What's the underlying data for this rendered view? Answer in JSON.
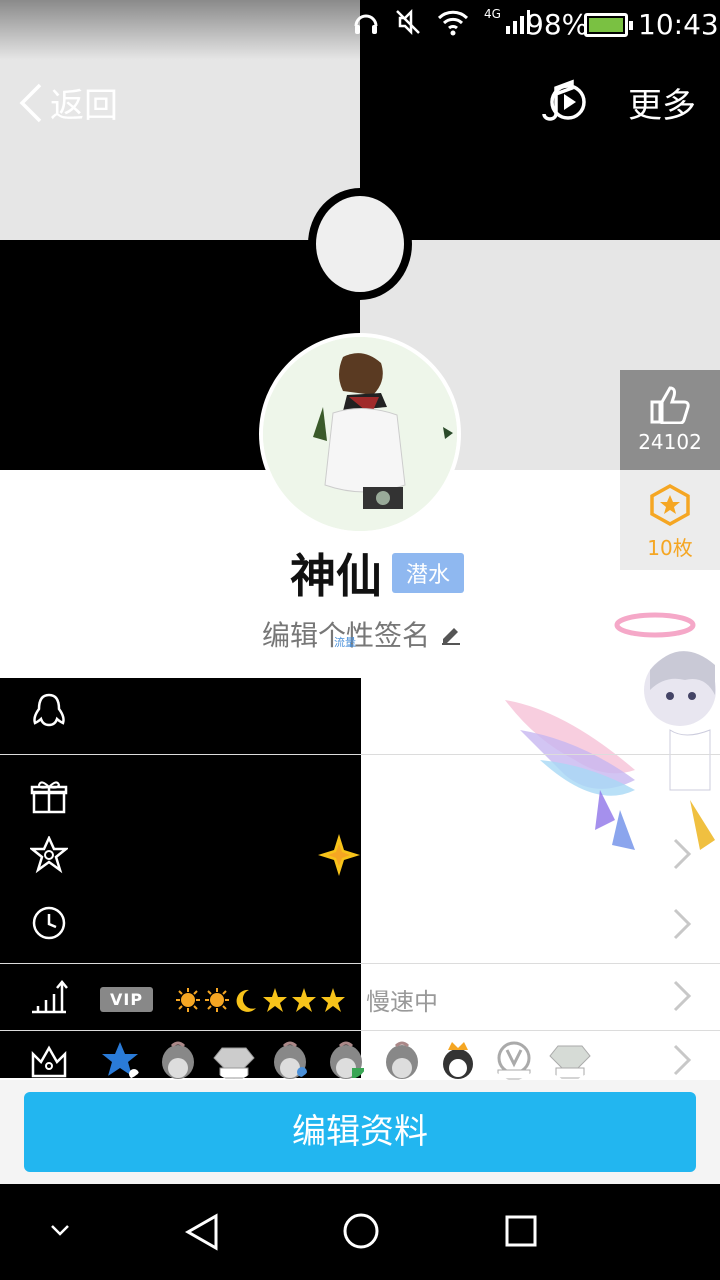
{
  "status_bar": {
    "network": "4G",
    "battery_percent": "98%",
    "time": "10:43",
    "icons": [
      "headphones-icon",
      "mute-icon",
      "wifi-icon",
      "signal-icon",
      "battery-icon"
    ]
  },
  "header": {
    "back_label": "返回",
    "more_label": "更多",
    "music_icon": "music-play-icon"
  },
  "side_panel": {
    "like_count": "24102",
    "medal_count": "10枚"
  },
  "profile": {
    "name": "神仙",
    "status_badge": "潜水",
    "signature": "编辑个性签名",
    "small_tag": "流量"
  },
  "rows": {
    "vip_tag": "VIP",
    "level_icons": [
      "sun",
      "sun",
      "moon",
      "star",
      "star",
      "star"
    ],
    "speed_text": "慢速中"
  },
  "colors": {
    "accent": "#22b6f0",
    "badge_bg": "#8fb8f0",
    "medal": "#f5a623"
  },
  "edit_button": "编辑资料"
}
